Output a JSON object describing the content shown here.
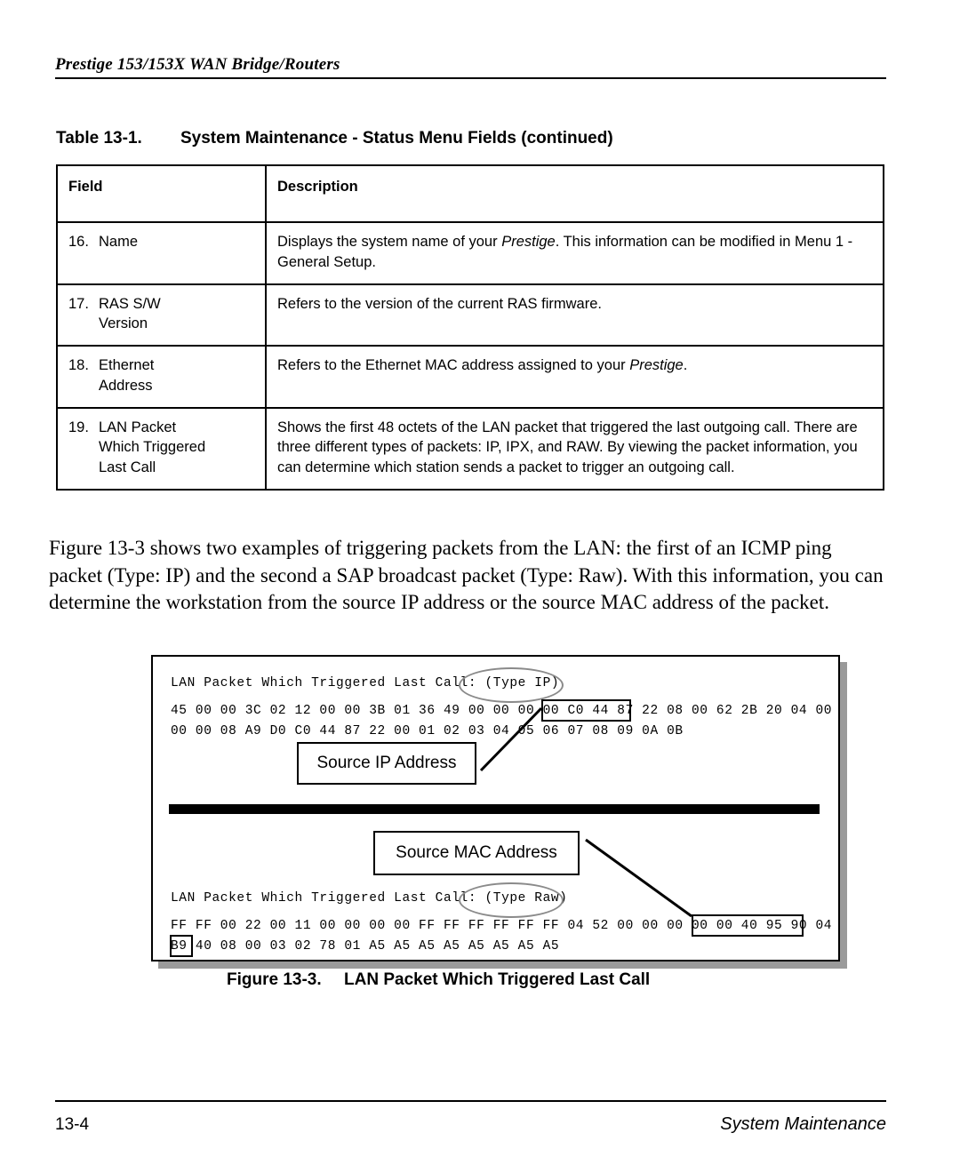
{
  "header": {
    "running_title": "Prestige 153/153X  WAN Bridge/Routers"
  },
  "table": {
    "caption_number": "Table 13-1.",
    "caption_title": "System Maintenance - Status Menu Fields (continued)",
    "columns": [
      "Field",
      "Description"
    ],
    "rows": [
      {
        "num": "16.",
        "field": "Name",
        "field_cont": "",
        "description_pre": "Displays the system name of your ",
        "description_em": "Prestige",
        "description_post": ". This information can be modified in Menu 1 - General Setup."
      },
      {
        "num": "17.",
        "field": "RAS S/W",
        "field_cont": "Version",
        "description_pre": "Refers to the version of the current RAS firmware.",
        "description_em": "",
        "description_post": ""
      },
      {
        "num": "18.",
        "field": "Ethernet",
        "field_cont": "Address",
        "description_pre": "Refers to the Ethernet MAC address assigned to your ",
        "description_em": "Prestige",
        "description_post": "."
      },
      {
        "num": "19.",
        "field": "LAN Packet",
        "field_cont": "Which Triggered\nLast Call",
        "description_pre": "Shows the first 48 octets of the LAN packet that triggered the last outgoing call. There are three different types of packets: IP, IPX, and RAW. By viewing the packet information, you can determine which station sends a packet to trigger an outgoing call.",
        "description_em": "",
        "description_post": ""
      }
    ]
  },
  "body": {
    "paragraph": "Figure 13-3 shows two examples of triggering packets from the LAN: the first of an ICMP ping packet (Type: IP) and the second a SAP broadcast packet (Type: Raw). With this information, you can determine the workstation from the source IP address or the source MAC address of the packet."
  },
  "figure": {
    "ip_packet": {
      "title": "LAN Packet Which Triggered Last Call:",
      "type_label": "(Type IP)",
      "hex_line_1": "45 00 00 3C 02 12 00 00 3B 01 36 49 00 00 00 00 C0 44 87 22 08 00 62 2B 20 04 00",
      "hex_line_2": "00 00 08 A9 D0 C0 44 87 22 00 01 02 03 04 05 06 07 08 09 0A 0B",
      "highlight_bytes": "C0 44 87 22"
    },
    "raw_packet": {
      "title": "LAN Packet Which Triggered Last Call:",
      "type_label": "(Type Raw)",
      "hex_line_1": "FF FF 00 22 00 11 00 00 00 00 FF FF FF FF FF FF 04 52 00 00 00 00 00 40 95 90 04",
      "hex_line_2": "B9 40 08 00 03 02 78 01 A5 A5 A5 A5 A5 A5 A5 A5",
      "highlight_bytes": "00 40 95 90 04 B9"
    },
    "callout_ip": "Source IP Address",
    "callout_mac": "Source MAC Address",
    "caption_number": "Figure 13-3.",
    "caption_title": "LAN Packet Which Triggered Last Call"
  },
  "footer": {
    "page_number": "13-4",
    "section": "System Maintenance"
  }
}
